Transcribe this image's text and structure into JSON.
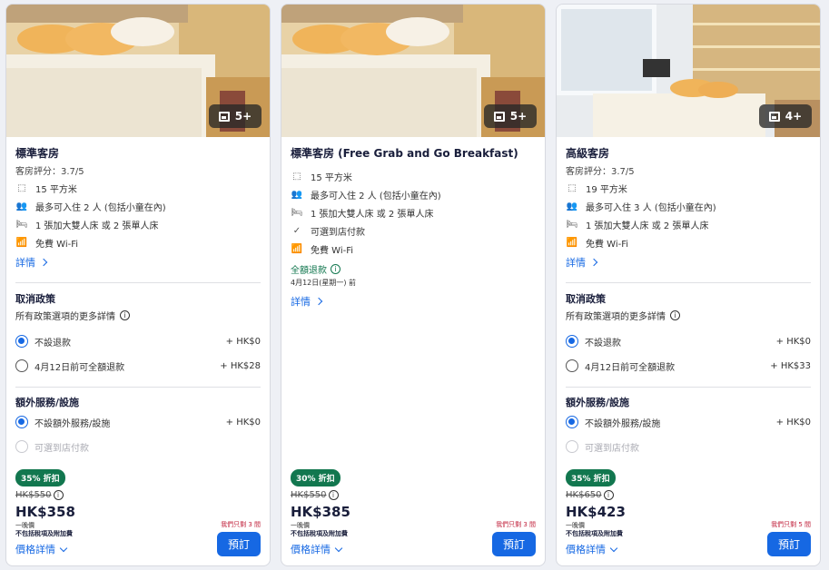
{
  "rooms": [
    {
      "gallery_count": "5+",
      "name": "標準客房",
      "rating": "客房評分：3.7/5",
      "features": [
        {
          "icon": "area-icon",
          "text": "15 平方米"
        },
        {
          "icon": "people-icon",
          "text": "最多可入住 2 人 (包括小童在內)"
        },
        {
          "icon": "bed-icon",
          "text": "1 張加大雙人床 或 2 張單人床"
        },
        {
          "icon": "wifi-icon",
          "text": "免費 Wi-Fi"
        }
      ],
      "details_link": "詳情",
      "cancel_title": "取消政策",
      "cancel_sub": "所有政策選項的更多詳情",
      "cancel_options": [
        {
          "label": "不設退款",
          "price": "+ HK$0",
          "selected": true
        },
        {
          "label": "4月12日前可全額退款",
          "price": "+ HK$28",
          "selected": false
        }
      ],
      "extras_title": "額外服務/設施",
      "extras_options": [
        {
          "label": "不設額外服務/設施",
          "price": "+ HK$0"
        },
        {
          "label": "可選到店付款",
          "price": ""
        }
      ],
      "discount": "35% 折扣",
      "old_price": "HK$550",
      "price": "HK$358",
      "price_note1": "一晚價",
      "price_note2": "不包括稅項及附加費",
      "rooms_left": "我們只剩 3 間",
      "price_details": "價格詳情",
      "book": "預訂"
    },
    {
      "gallery_count": "5+",
      "name": "標準客房 (Free Grab and Go Breakfast)",
      "features": [
        {
          "icon": "area-icon",
          "text": "15 平方米"
        },
        {
          "icon": "people-icon",
          "text": "最多可入住 2 人 (包括小童在內)"
        },
        {
          "icon": "bed-icon",
          "text": "1 張加大雙人床 或 2 張單人床"
        },
        {
          "icon": "check-icon",
          "text": "可選到店付款"
        },
        {
          "icon": "wifi-icon",
          "text": "免費 Wi-Fi"
        }
      ],
      "refund": "全額退款",
      "refund_date": "4月12日(星期一) 前",
      "details_link": "詳情",
      "discount": "30% 折扣",
      "old_price": "HK$550",
      "price": "HK$385",
      "price_note1": "一晚價",
      "price_note2": "不包括稅項及附加費",
      "rooms_left": "我們只剩 3 間",
      "price_details": "價格詳情",
      "book": "預訂"
    },
    {
      "gallery_count": "4+",
      "name": "高級客房",
      "rating": "客房評分：3.7/5",
      "features": [
        {
          "icon": "area-icon",
          "text": "19 平方米"
        },
        {
          "icon": "people-icon",
          "text": "最多可入住 3 人 (包括小童在內)"
        },
        {
          "icon": "bed-icon",
          "text": "1 張加大雙人床 或 2 張單人床"
        },
        {
          "icon": "wifi-icon",
          "text": "免費 Wi-Fi"
        }
      ],
      "details_link": "詳情",
      "cancel_title": "取消政策",
      "cancel_sub": "所有政策選項的更多詳情",
      "cancel_options": [
        {
          "label": "不設退款",
          "price": "+ HK$0",
          "selected": true
        },
        {
          "label": "4月12日前可全額退款",
          "price": "+ HK$33",
          "selected": false
        }
      ],
      "extras_title": "額外服務/設施",
      "extras_options": [
        {
          "label": "不設額外服務/設施",
          "price": "+ HK$0"
        },
        {
          "label": "可選到店付款",
          "price": ""
        }
      ],
      "discount": "35% 折扣",
      "old_price": "HK$650",
      "price": "HK$423",
      "price_note1": "一晚價",
      "price_note2": "不包括稅項及附加費",
      "rooms_left": "我們只剩 5 間",
      "price_details": "價格詳情",
      "book": "預訂"
    }
  ],
  "colors": {
    "accent": "#1668e3",
    "discount_green": "#12774f",
    "urgency_red": "#c0203b"
  }
}
